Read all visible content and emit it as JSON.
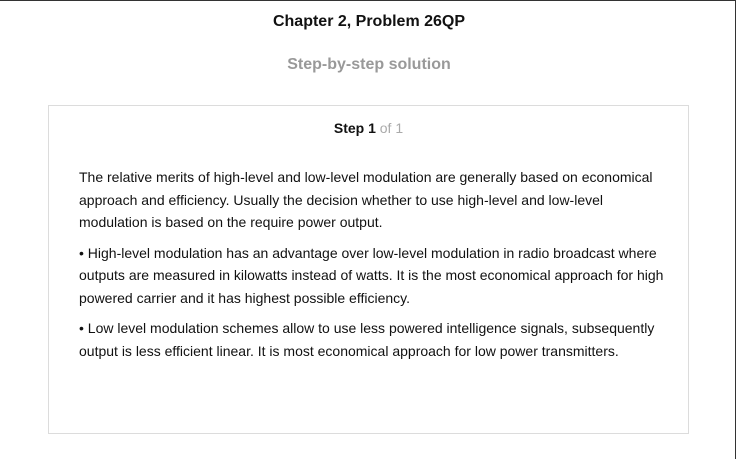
{
  "header": {
    "title": "Chapter 2, Problem 26QP",
    "subtitle": "Step-by-step solution"
  },
  "step": {
    "label": "Step 1",
    "of_text": "of 1"
  },
  "solution": {
    "paragraphs": [
      "The relative merits of high-level and low-level modulation are generally based on economical approach and efficiency. Usually the decision whether to use high-level and low-level modulation is based on the require power output.",
      "• High-level modulation has an advantage over low-level modulation in radio broadcast where outputs are measured in kilowatts instead of watts. It is the most economical approach for high powered carrier and it has highest possible efficiency.",
      "• Low level modulation schemes allow to use less powered intelligence signals, subsequently output is less efficient linear. It is most economical approach for low power transmitters."
    ]
  }
}
